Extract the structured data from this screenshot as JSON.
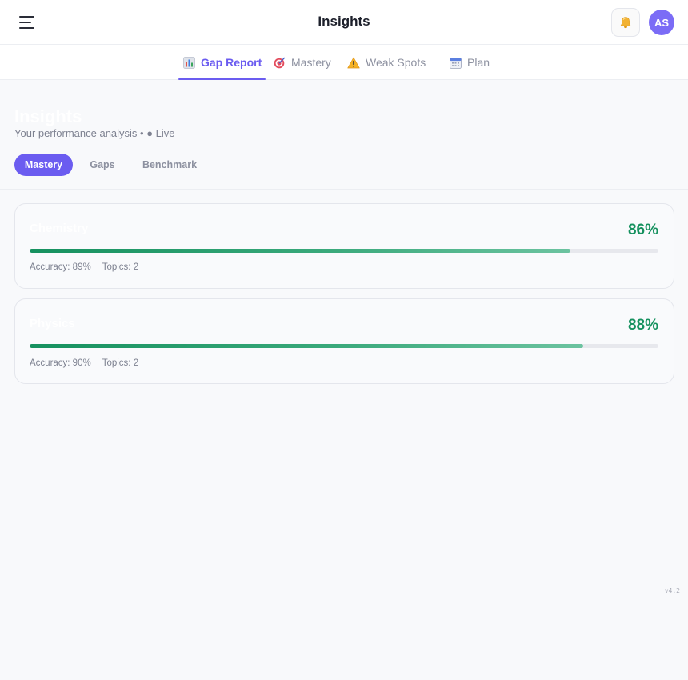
{
  "header": {
    "title": "Insights",
    "avatar_initials": "AS",
    "menu_icon": "hamburger-icon",
    "notification_icon": "bell-icon"
  },
  "tabs": [
    {
      "label": "Gap Report",
      "icon": "bar-chart-icon",
      "active": true
    },
    {
      "label": "Mastery",
      "icon": "target-icon",
      "active": false
    },
    {
      "label": "Weak Spots",
      "icon": "warning-icon",
      "active": false
    },
    {
      "label": "Plan",
      "icon": "calendar-icon",
      "active": false
    }
  ],
  "page": {
    "heading": "Insights",
    "subtitle": "Your performance analysis • ● Live"
  },
  "segments": [
    {
      "label": "Mastery",
      "active": true
    },
    {
      "label": "Gaps",
      "active": false
    },
    {
      "label": "Benchmark",
      "active": false
    }
  ],
  "cards": [
    {
      "subject": "Chemistry",
      "mastery": "86%",
      "mastery_value": 0.86,
      "accuracy": "Accuracy: 89%",
      "topics": "Topics: 2"
    },
    {
      "subject": "Physics",
      "mastery": "88%",
      "mastery_value": 0.88,
      "accuracy": "Accuracy: 90%",
      "topics": "Topics: 2"
    }
  ],
  "footer": {
    "version": "v4.2"
  },
  "colors": {
    "accent": "#6b5cf0",
    "success": "#16915f",
    "avatar_bg": "#7b6cf6"
  }
}
